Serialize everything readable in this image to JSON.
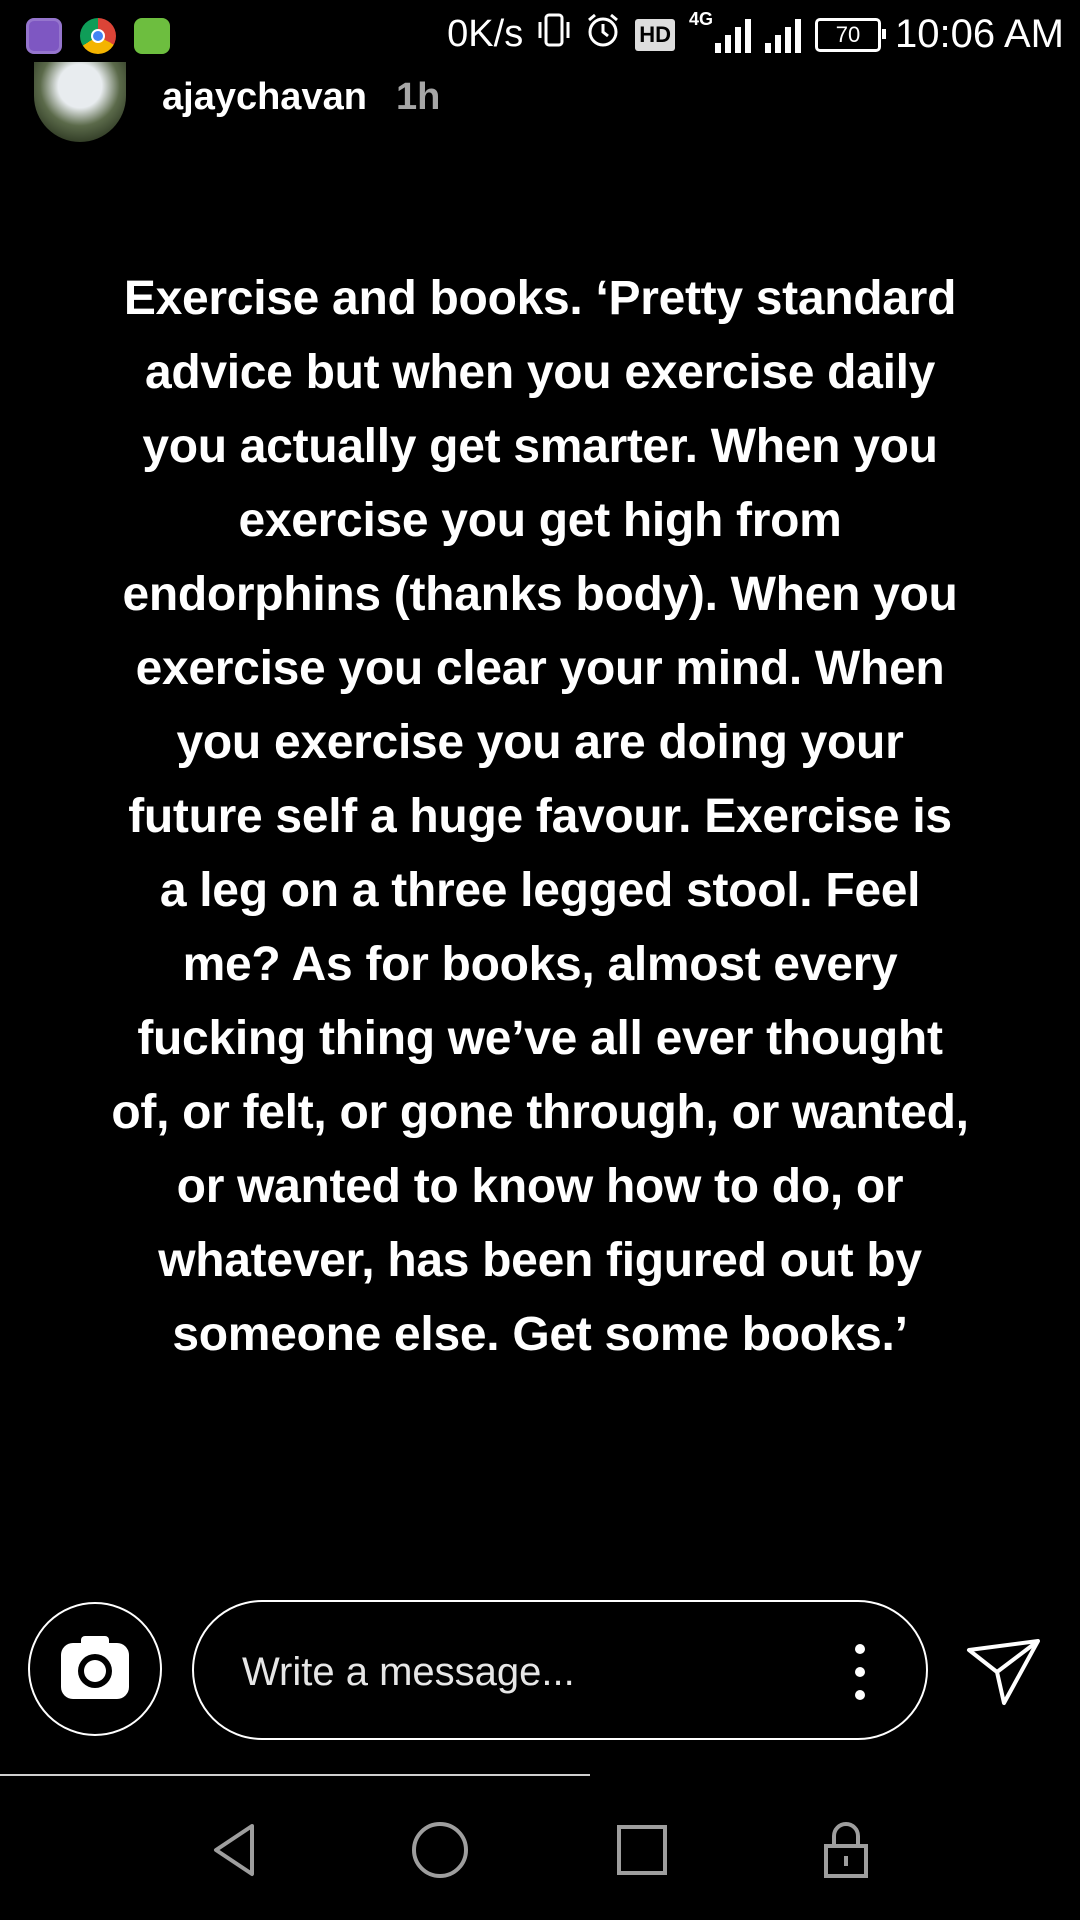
{
  "status_bar": {
    "speed": "0K/s",
    "network_type": "4G",
    "hd_label": "HD",
    "battery": "70",
    "time": "10:06 AM",
    "icons": [
      "gallery-icon",
      "chrome-icon",
      "shield-icon",
      "vibrate-icon",
      "alarm-icon",
      "signal-icon",
      "battery-icon"
    ]
  },
  "story": {
    "username": "ajaychavan",
    "time_ago": "1h",
    "text": "Exercise and books. ‘Pretty standard\nadvice but when you exercise daily\nyou actually get smarter. When you\nexercise you get high from\nendorphins (thanks body). When you\nexercise you clear your mind. When\nyou exercise you are doing your\nfuture self a huge favour. Exercise is\na leg on a three legged stool. Feel\nme? As for books, almost every\nfucking thing we’ve all ever thought\nof, or felt, or gone through, or wanted,\nor wanted to know how to do, or\nwhatever, has been figured out by\nsomeone else. Get some books.’"
  },
  "reply_bar": {
    "placeholder": "Write a message...",
    "icons": [
      "camera-icon",
      "more-vertical-icon",
      "send-icon"
    ]
  },
  "navigation": {
    "icons": [
      "back-icon",
      "home-icon",
      "recents-icon",
      "lock-icon"
    ]
  },
  "colors": {
    "background": "#000000",
    "text": "#ffffff",
    "muted": "#a6a6a6"
  }
}
